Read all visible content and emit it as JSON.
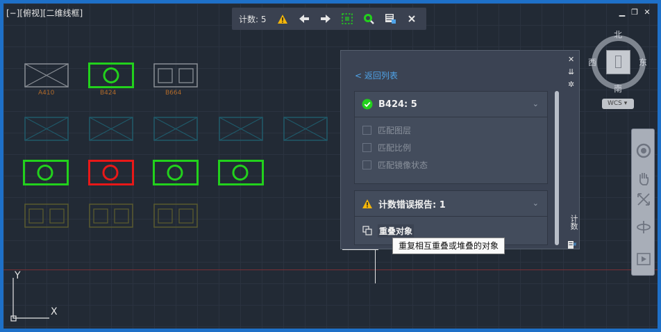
{
  "viewport": {
    "label": "[−][俯视][二维线框]"
  },
  "window_controls": {
    "minimize": "▁",
    "restore": "❐",
    "close": "✕"
  },
  "count_toolbar": {
    "label": "计数:",
    "count": "5"
  },
  "blocks": {
    "a410": "A410",
    "b424": "B424",
    "b664": "B664"
  },
  "ucs": {
    "y": "Y",
    "x": "X"
  },
  "panel": {
    "back_link": "< 返回列表",
    "close": "✕",
    "pin": "⇊",
    "settings": "✲",
    "vertical_title": "计数",
    "block_section": {
      "title": "B424: 5",
      "options": [
        "匹配图层",
        "匹配比例",
        "匹配镜像状态"
      ]
    },
    "error_section": {
      "title": "计数错误报告: 1",
      "item": "重叠对象"
    }
  },
  "tooltip": "重复相互重叠或堆叠的对象",
  "viewcube": {
    "north": "北",
    "south": "南",
    "west": "西",
    "east": "东",
    "wcs": "WCS"
  },
  "colors": {
    "green": "#22d11c",
    "red": "#e81818",
    "accent": "#4fa3e8",
    "warning": "#f5b60a"
  }
}
